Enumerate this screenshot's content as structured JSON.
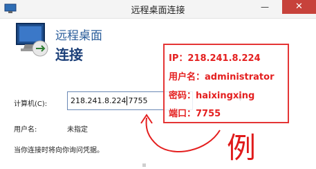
{
  "window": {
    "title": "远程桌面连接",
    "minimize_symbol": "—",
    "close_symbol": "✕"
  },
  "header": {
    "subtitle": "远程桌面",
    "title": "连接"
  },
  "form": {
    "computer_label": "计算机(C):",
    "computer_value": "218.241.8.224",
    "computer_value_suffix": "7755",
    "user_label": "用户名:",
    "user_value": "未指定",
    "note": "当你连接时将向你询问凭据。"
  },
  "annotation": {
    "lines": [
      "IP：218.241.8.224",
      "用户名：administrator",
      "密码：haixingxing",
      "端口：7755"
    ],
    "example_char": "例",
    "color": "#e41f1f"
  },
  "colors": {
    "accent": "#1b3f78",
    "close_button": "#c7423b"
  }
}
